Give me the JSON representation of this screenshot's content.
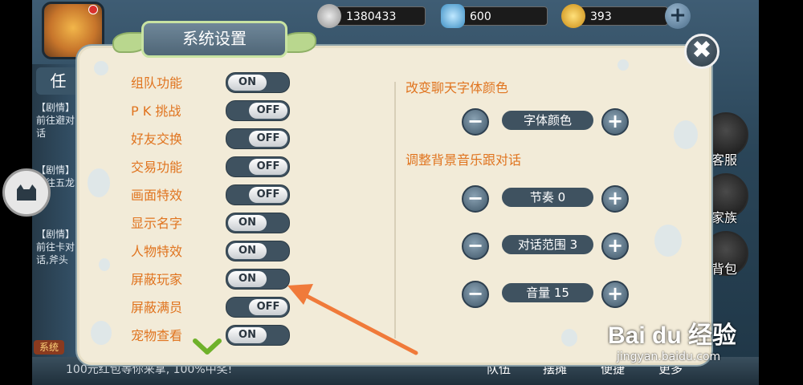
{
  "resources": {
    "silver": "1380433",
    "crystal": "600",
    "gold": "393"
  },
  "dialog": {
    "title": "系统设置",
    "close_glyph": "✖"
  },
  "settings": [
    {
      "label": "组队功能",
      "state": "ON"
    },
    {
      "label": "P K 挑战",
      "state": "OFF"
    },
    {
      "label": "好友交换",
      "state": "OFF"
    },
    {
      "label": "交易功能",
      "state": "OFF"
    },
    {
      "label": "画面特效",
      "state": "OFF"
    },
    {
      "label": "显示名字",
      "state": "ON"
    },
    {
      "label": "人物特效",
      "state": "ON"
    },
    {
      "label": "屏蔽玩家",
      "state": "ON"
    },
    {
      "label": "屏蔽满员",
      "state": "OFF"
    },
    {
      "label": "宠物查看",
      "state": "ON"
    }
  ],
  "right_panel": {
    "chat_font_heading": "改变聊天字体颜色",
    "font_color_label": "字体颜色",
    "audio_heading": "调整背景音乐跟对话",
    "rhythm_label": "节奏 0",
    "dialog_range_label": "对话范围 3",
    "volume_label": "音量 15",
    "minus_glyph": "−",
    "plus_glyph": "+"
  },
  "background": {
    "left_tab": "任",
    "quest_1": "【剧情】前往避对话",
    "quest_2": "【剧情】前往五龙吉",
    "quest_3": "【剧情】前往卡对话,斧头",
    "side_buttons": [
      "客服",
      "家族",
      "背包"
    ],
    "system_tag": "系统",
    "ticker": "100元红包等你来拿, 100%中奖!",
    "bottom_tabs": [
      "队伍",
      "摆摊",
      "便捷",
      "更多"
    ],
    "top_plus": "+"
  },
  "watermark": {
    "brand": "Bai du 经验",
    "url": "jingyan.baidu.com"
  },
  "colors": {
    "accent_orange": "#e0741f",
    "panel_bg": "#f2ebd8",
    "toggle_track": "#3f5260",
    "arrow": "#f07a3a"
  },
  "icons": [
    "silver-coin-icon",
    "crystal-icon",
    "gold-coin-icon",
    "close-icon",
    "chevron-down-icon",
    "minus-icon",
    "plus-icon",
    "cat-icon"
  ]
}
